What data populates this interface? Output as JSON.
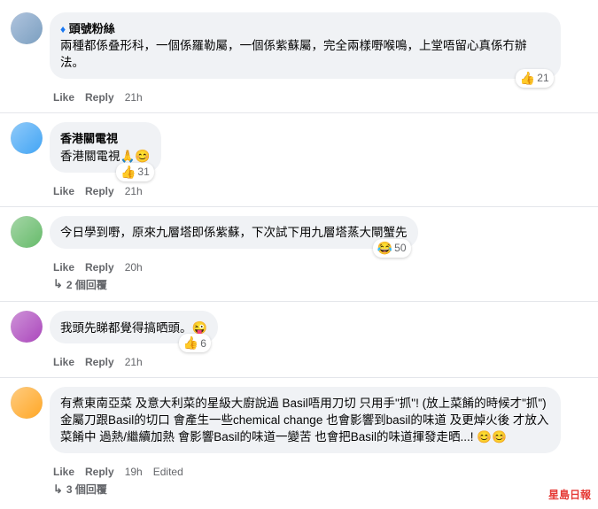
{
  "comments": [
    {
      "id": "c1",
      "author": "頭號粉絲",
      "badge": "diamond",
      "avatar_color": "#b0c4de",
      "text": "兩種都係叠形科，一個係羅勒屬，一個係紫蘇屬，完全兩樣嘢喉鳴，上堂唔留心真係冇辦法。",
      "time": "21h",
      "reactions": [
        {
          "type": "like",
          "count": 21
        }
      ],
      "reply_count": null,
      "edited": false
    },
    {
      "id": "c2",
      "author": "香港關電視",
      "badge": null,
      "avatar_color": "#90caf9",
      "text": "香港關電視🙏😊",
      "text_suffix": "31",
      "time": "21h",
      "reactions": [
        {
          "type": "like",
          "count": 31
        }
      ],
      "reply_count": null,
      "edited": false
    },
    {
      "id": "c3",
      "author": null,
      "badge": null,
      "avatar_color": "#a5d6a7",
      "text": "今日學到嘢，原來九層塔即係紫蘇，下次試下用九層塔蒸大閘蟹先",
      "time": "20h",
      "reactions": [
        {
          "type": "haha",
          "count": 50
        }
      ],
      "reply_count": 2,
      "edited": false
    },
    {
      "id": "c4",
      "author": null,
      "badge": null,
      "avatar_color": "#ce93d8",
      "text": "我頭先睇都覺得搞晒頭。😜",
      "time": "21h",
      "reactions": [
        {
          "type": "like",
          "count": 6
        }
      ],
      "reply_count": null,
      "edited": false
    },
    {
      "id": "c5",
      "author": null,
      "badge": null,
      "avatar_color": "#ffcc80",
      "text": "有煮東南亞菜 及意大利菜的星級大廚說過 Basil唔用刀切 只用手\"抓\"! (放上菜餚的時候才\"抓\") 金屬刀跟Basil的切口 會產生一些chemical change 也會影響到basil的味道 及更焯火後 才放入菜餚中 過熱/繼續加熱 會影響Basil的味道一變苦 也會把Basil的味道揮發走晒...! 😊😊",
      "time": "19h",
      "reactions": [],
      "reply_count": 3,
      "edited": true
    }
  ],
  "actions": {
    "like": "Like",
    "reply": "Reply",
    "edited": "Edited"
  },
  "reply_counts": {
    "two": "2 個回覆",
    "three": "3 個回覆"
  },
  "watermark": {
    "text1": "星島",
    "text2": "日報"
  }
}
